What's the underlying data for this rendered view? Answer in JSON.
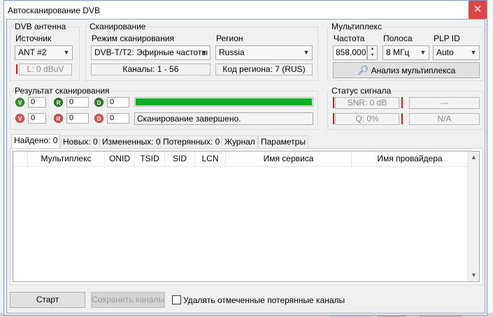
{
  "window": {
    "title": "Автосканирование DVB",
    "close_glyph": "✕"
  },
  "antenna": {
    "group_label": "DVB антенна",
    "source_label": "Источник",
    "source_value": "ANT #2",
    "level": "L: 0 dBuV"
  },
  "scan": {
    "group_label": "Сканирование",
    "mode_label": "Режим сканирования",
    "mode_value": "DVB-T/T2: Эфирные частоты",
    "region_label": "Регион",
    "region_value": "Russia",
    "channels": "Каналы: 1 - 56",
    "region_code": "Код региона: 7 (RUS)"
  },
  "multiplex": {
    "group_label": "Мультиплекс",
    "freq_label": "Частота",
    "freq_value": "858,000",
    "band_label": "Полоса",
    "band_value": "8 МГц",
    "plp_label": "PLP ID",
    "plp_value": "Auto",
    "analyze_label": "Анализ мультиплекса"
  },
  "result": {
    "group_label": "Результат сканирования",
    "row1": {
      "v": "V",
      "v_count": "0",
      "r": "R",
      "r_count": "0",
      "d": "D",
      "d_count": "0"
    },
    "row2": {
      "v": "V",
      "v_count": "0",
      "r": "R",
      "r_count": "0",
      "d": "D",
      "d_count": "0"
    },
    "progress_fraction": 1.0,
    "status": "Сканирование завершено."
  },
  "signal": {
    "group_label": "Статус сигнала",
    "snr": "SNR: 0 dB",
    "q": "Q: 0%",
    "snr_extra": "---",
    "q_extra": "N/A"
  },
  "tabs": [
    {
      "label": "Найдено: 0"
    },
    {
      "label": "Новых: 0"
    },
    {
      "label": "Измененных: 0"
    },
    {
      "label": "Потерянных: 0"
    },
    {
      "label": "Журнал"
    },
    {
      "label": "Параметры"
    }
  ],
  "table": {
    "columns": [
      "Мультиплекс",
      "ONID",
      "TSID",
      "SID",
      "LCN",
      "Имя сервиса",
      "Имя провайдера"
    ],
    "rows": []
  },
  "footer": {
    "start_label": "Старт",
    "save_label": "Сохранить каналы",
    "delete_lost_label": "Удалять отмеченные потерянные каналы",
    "delete_lost_checked": false
  },
  "colors": {
    "progress": "#06b025",
    "close": "#e04343",
    "accent_red": "#d41c1c"
  }
}
